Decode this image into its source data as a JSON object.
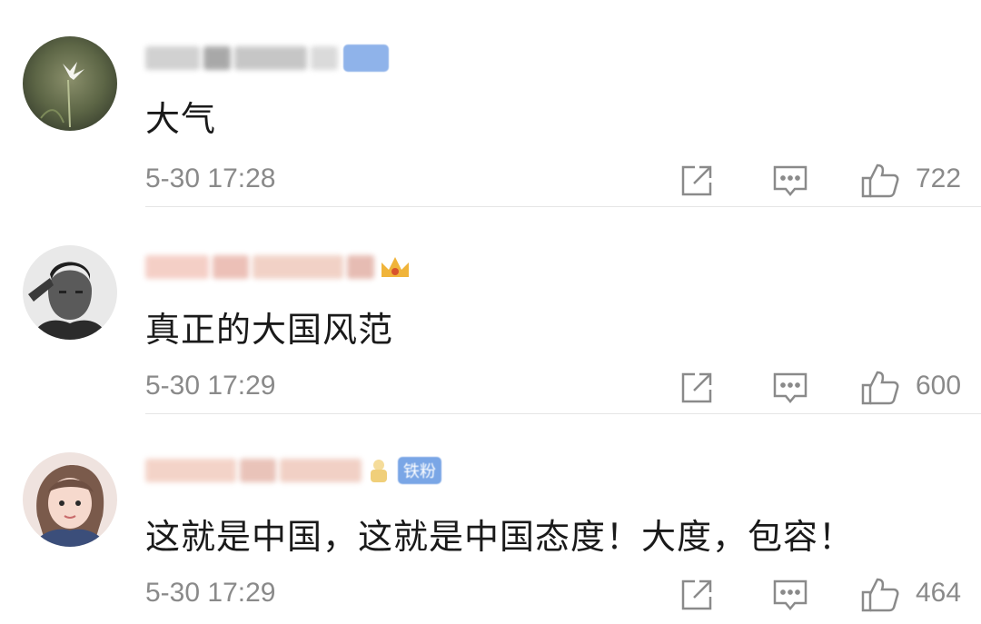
{
  "comments": [
    {
      "text": "大气",
      "time": "5-30 17:28",
      "likes": "722",
      "badge": ""
    },
    {
      "text": "真正的大国风范",
      "time": "5-30 17:29",
      "likes": "600",
      "badge": ""
    },
    {
      "text": "这就是中国，这就是中国态度！大度，包容！",
      "time": "5-30 17:29",
      "likes": "464",
      "badge": "铁粉"
    }
  ],
  "icons": {
    "share": "share-icon",
    "reply": "reply-icon",
    "like": "thumbs-up-icon",
    "crown": "crown-icon",
    "vip": "vip-badge"
  },
  "colors": {
    "text": "#1a1a1a",
    "meta": "#8a8a8a",
    "badge_blue": "#7aa6e6",
    "crown_gold": "#f0b43a",
    "divider": "#e6e6e6"
  }
}
